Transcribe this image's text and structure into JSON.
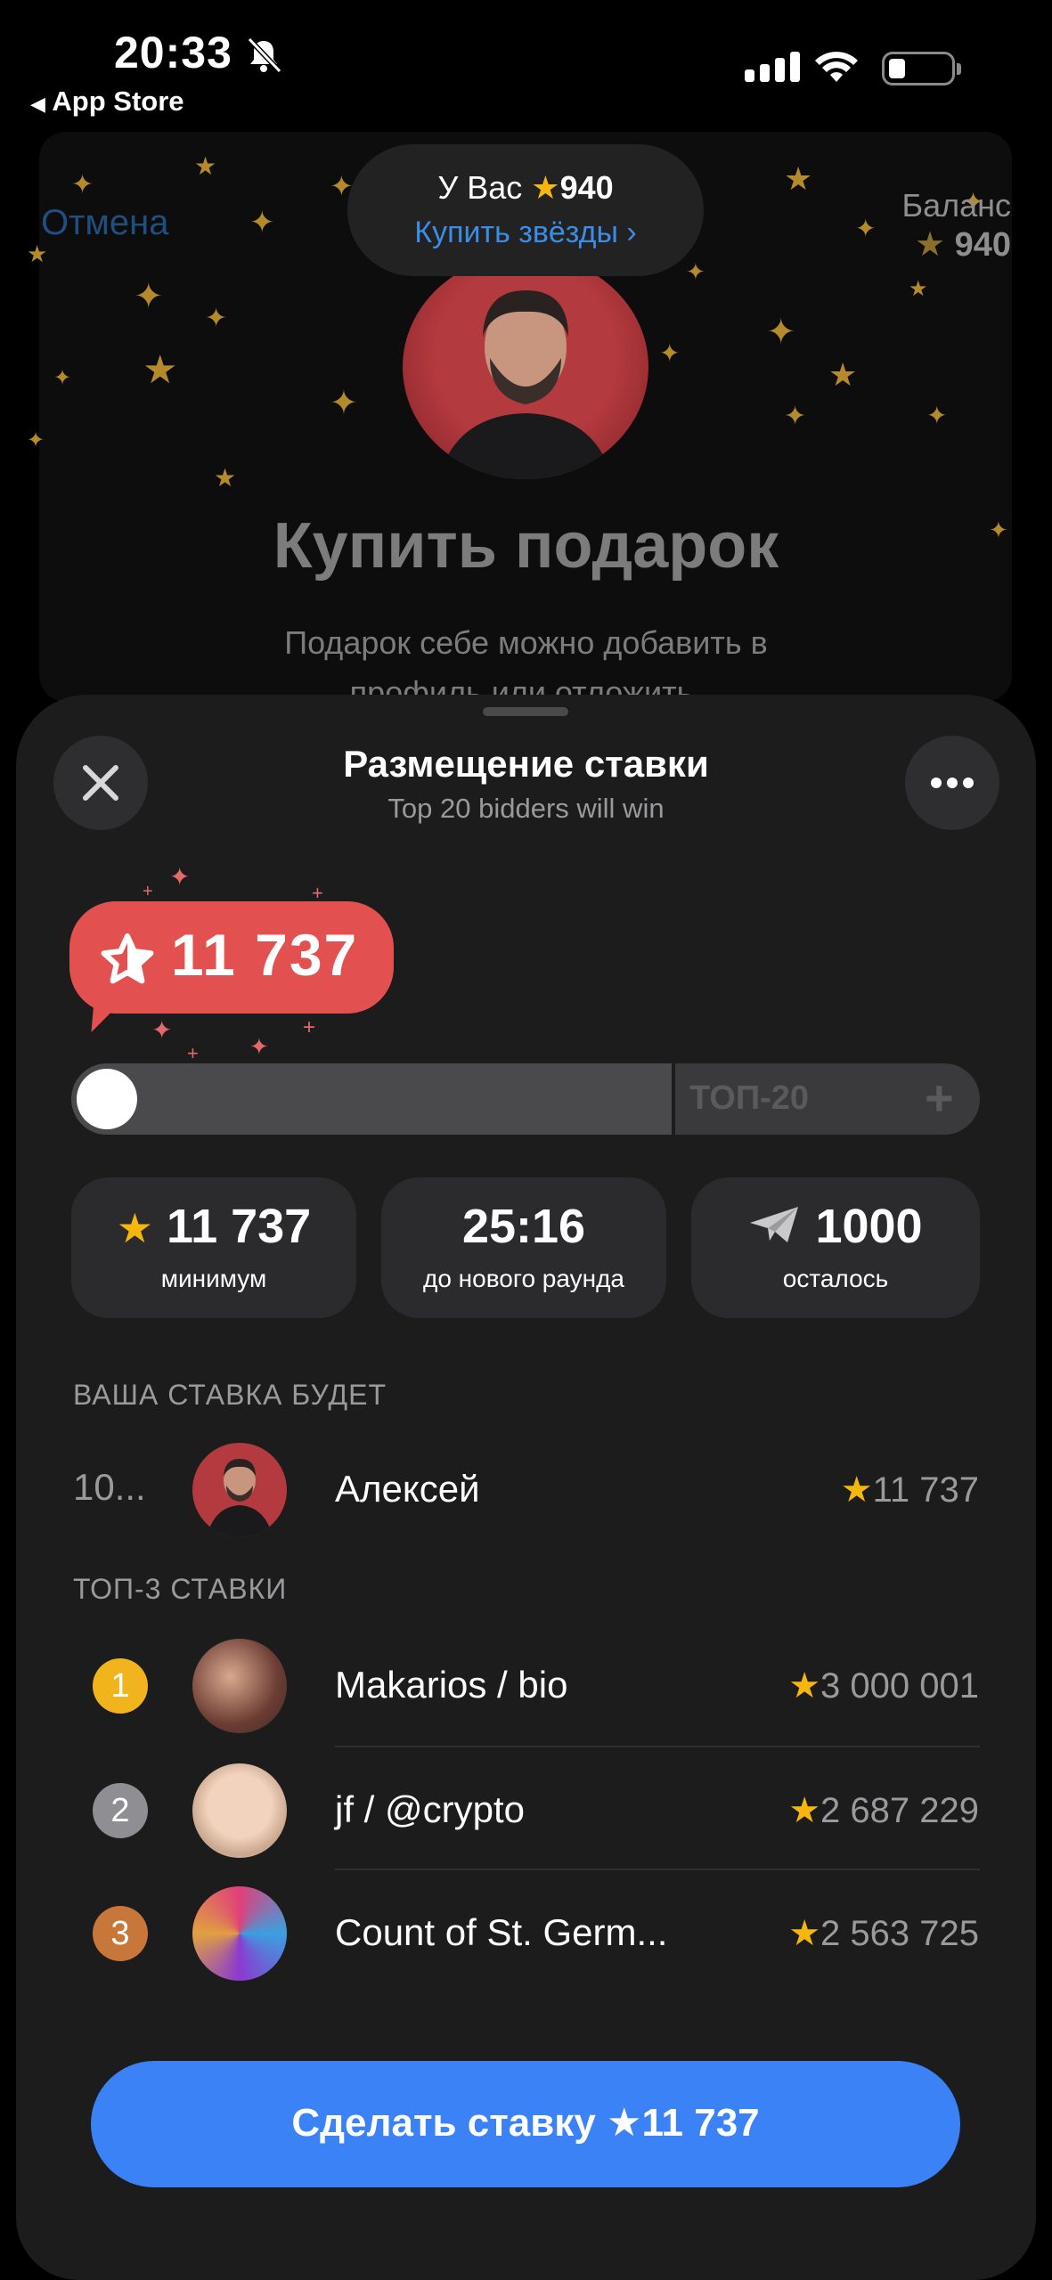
{
  "status_bar": {
    "time": "20:33",
    "back_app": "App Store"
  },
  "background_page": {
    "cancel_label": "Отмена",
    "balance_label": "Баланс",
    "balance_value": "940",
    "title": "Купить подарок",
    "subtitle_line1": "Подарок себе можно добавить в",
    "subtitle_line2": "профиль или отложить."
  },
  "tooltip": {
    "prefix": "У Вас",
    "stars": "940",
    "buy_link": "Купить звёзды"
  },
  "sheet": {
    "title": "Размещение ставки",
    "subtitle": "Top 20 bidders will win",
    "bid_bubble_value": "11 737",
    "slider": {
      "label": "ТОП-20",
      "plus": "+",
      "level": 0.0
    },
    "stats": [
      {
        "value": "11 737",
        "caption": "минимум",
        "icon": "star-icon"
      },
      {
        "value": "25:16",
        "caption": "до нового раунда",
        "icon": ""
      },
      {
        "value": "1000",
        "caption": "осталось",
        "icon": "plane-icon"
      }
    ],
    "your_bid": {
      "section_label": "ВАША СТАВКА БУДЕТ",
      "place": "10...",
      "name": "Алексей",
      "amount": "11 737"
    },
    "top3": {
      "section_label": "ТОП-3 СТАВКИ",
      "rows": [
        {
          "rank": "1",
          "name": "Makarios / bio",
          "amount": "3 000 001",
          "rank_color": "#f2b41d"
        },
        {
          "rank": "2",
          "name": "jf / @crypto",
          "amount": "2 687 229",
          "rank_color": "#8e8e93"
        },
        {
          "rank": "3",
          "name": "Count of St. Germ...",
          "amount": "2 563 725",
          "rank_color": "#c8773a"
        }
      ]
    },
    "cta_label": "Сделать ставку",
    "cta_amount": "11 737"
  },
  "colors": {
    "accent": "#3a82f6",
    "bid_bubble": "#e2514f",
    "star": "#f5b60e",
    "sheet_bg": "#1c1c1d"
  }
}
